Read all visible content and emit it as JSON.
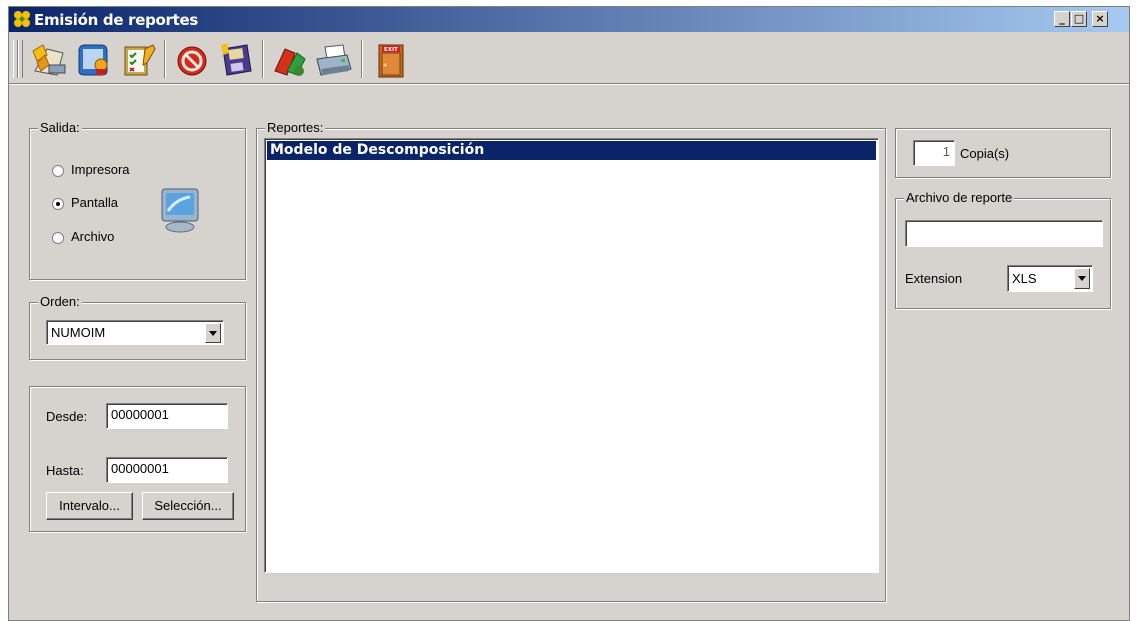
{
  "window": {
    "title": "Emisión de reportes",
    "minimize": "_",
    "maximize": "□",
    "close": "×"
  },
  "toolbar": {
    "buttons": [
      {
        "name": "run-report-icon"
      },
      {
        "name": "query-icon"
      },
      {
        "name": "checklist-icon"
      },
      {
        "name": "cancel-icon"
      },
      {
        "name": "save-icon"
      },
      {
        "name": "clear-icon"
      },
      {
        "name": "printer-icon"
      },
      {
        "name": "exit-icon"
      }
    ]
  },
  "salida": {
    "legend": "Salida:",
    "options": [
      "Impresora",
      "Pantalla",
      "Archivo"
    ],
    "selected": "Pantalla"
  },
  "orden": {
    "legend": "Orden:",
    "value": "NUMOIM"
  },
  "rango": {
    "desde_label": "Desde:",
    "desde_value": "00000001",
    "hasta_label": "Hasta:",
    "hasta_value": "00000001",
    "intervalo_button": "Intervalo...",
    "seleccion_button": "Selección..."
  },
  "reportes": {
    "legend": "Reportes:",
    "items": [
      "Modelo de Descomposición"
    ]
  },
  "copias": {
    "value": "1",
    "label": "Copia(s)"
  },
  "archivo": {
    "legend": "Archivo de reporte",
    "path_value": "",
    "extension_label": "Extension",
    "extension_value": "XLS"
  },
  "colors": {
    "title_gradient_start": "#0a246a",
    "title_gradient_end": "#a6caf0",
    "face": "#d6d3ce",
    "selection": "#0a246a"
  }
}
